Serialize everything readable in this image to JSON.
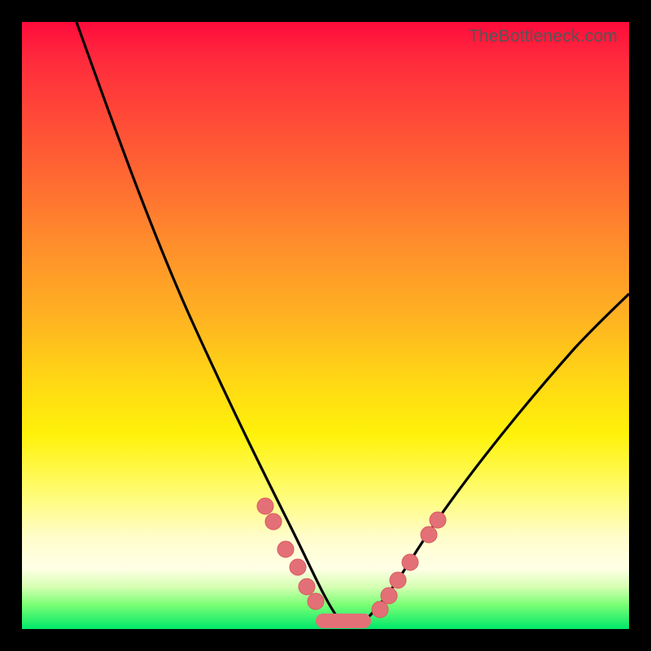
{
  "watermark": "TheBottleneck.com",
  "colors": {
    "page_bg": "#000000",
    "gradient_top": "#ff0b3c",
    "gradient_bottom": "#00e86a",
    "curve": "#000000",
    "marker_fill": "#e37076",
    "marker_stroke": "#d85a60"
  },
  "chart_data": {
    "type": "line",
    "title": "",
    "xlabel": "",
    "ylabel": "",
    "xlim": [
      0,
      100
    ],
    "ylim": [
      0,
      100
    ],
    "grid": false,
    "legend": false,
    "series": [
      {
        "name": "curve",
        "x": [
          9,
          12,
          16,
          20,
          24,
          28,
          32,
          36,
          38,
          40,
          42,
          44,
          46,
          48,
          50,
          52,
          54,
          56,
          58,
          60,
          62,
          66,
          72,
          80,
          90,
          100
        ],
        "y": [
          100,
          90,
          78,
          66,
          55,
          45,
          36,
          27,
          23,
          20,
          16,
          13,
          10,
          7,
          4,
          2,
          1,
          1,
          2,
          4,
          7,
          12,
          20,
          30,
          42,
          54
        ]
      }
    ],
    "markers": {
      "left": [
        {
          "x": 40.0,
          "y": 20.0
        },
        {
          "x": 41.5,
          "y": 17.5
        },
        {
          "x": 43.5,
          "y": 13.0
        },
        {
          "x": 45.5,
          "y": 10.0
        },
        {
          "x": 47.0,
          "y": 7.0
        },
        {
          "x": 48.5,
          "y": 4.5
        }
      ],
      "right": [
        {
          "x": 59.0,
          "y": 3.0
        },
        {
          "x": 60.5,
          "y": 5.5
        },
        {
          "x": 62.0,
          "y": 8.0
        },
        {
          "x": 64.0,
          "y": 11.0
        },
        {
          "x": 67.0,
          "y": 15.5
        },
        {
          "x": 68.5,
          "y": 18.0
        }
      ],
      "flat_segment": {
        "x_start": 50,
        "x_end": 57,
        "y": 1
      }
    },
    "annotations": []
  }
}
